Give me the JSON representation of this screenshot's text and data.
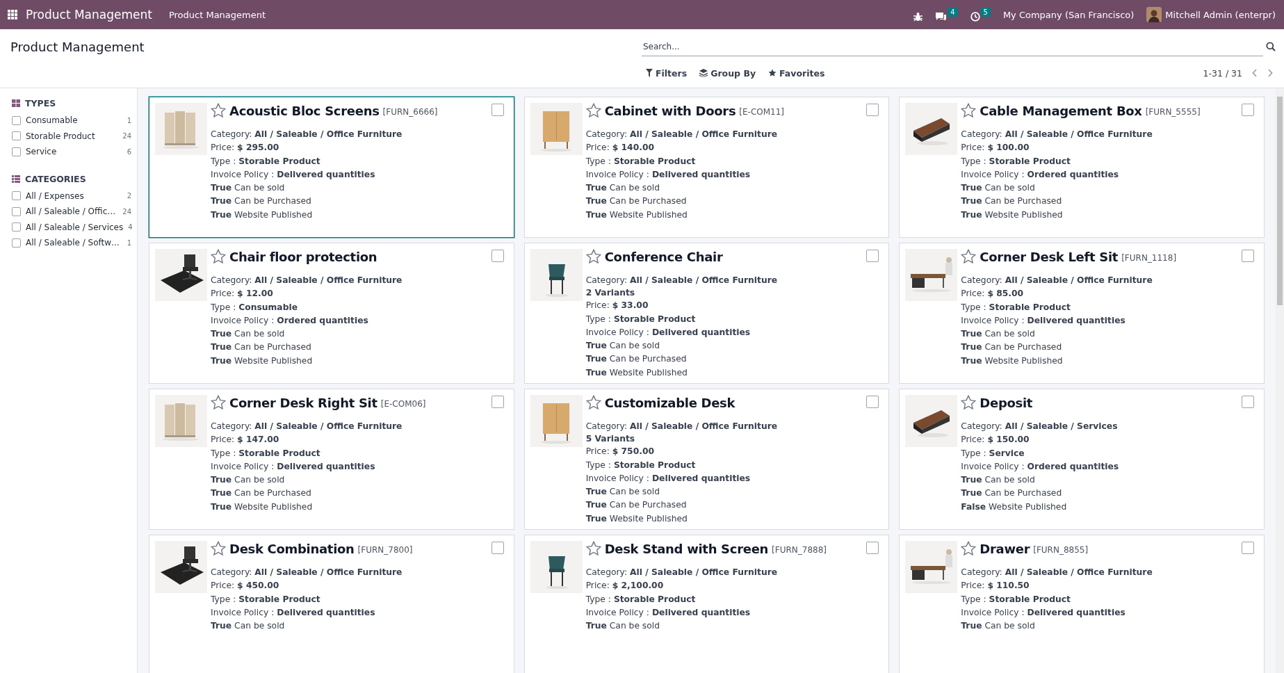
{
  "navbar": {
    "app_title": "Product Management",
    "menu": [
      {
        "label": "Product Management"
      }
    ],
    "messages_badge": "4",
    "activities_badge": "5",
    "company": "My Company (San Francisco)",
    "user": "Mitchell Admin (enterpr)"
  },
  "control_panel": {
    "title": "Product Management",
    "search": {
      "placeholder": "Search..."
    },
    "filters": "Filters",
    "group_by": "Group By",
    "favorites": "Favorites",
    "pager": "1-31 / 31"
  },
  "search_panel": {
    "sections": [
      {
        "kind": "types",
        "title": "TYPES",
        "items": [
          {
            "label": "Consumable",
            "count": "1",
            "checked": false
          },
          {
            "label": "Storable Product",
            "count": "24",
            "checked": false
          },
          {
            "label": "Service",
            "count": "6",
            "checked": false
          }
        ]
      },
      {
        "kind": "categories",
        "title": "CATEGORIES",
        "items": [
          {
            "label": "All / Expenses",
            "count": "2",
            "checked": false
          },
          {
            "label": "All / Saleable / Offic…",
            "count": "24",
            "checked": false
          },
          {
            "label": "All / Saleable / Services",
            "count": "4",
            "checked": false
          },
          {
            "label": "All / Saleable / Softw…",
            "count": "1",
            "checked": false
          }
        ]
      }
    ]
  },
  "cards": [
    {
      "name": "Acoustic Bloc Screens",
      "ref": "[FURN_6666]",
      "favorite": false,
      "checked": false,
      "focused": true,
      "details": [
        {
          "kind": "text",
          "text": "Category: **All / Saleable / Office Furniture**"
        },
        {
          "kind": "text",
          "text": "Price: **$ 295.00**"
        },
        {
          "kind": "text",
          "text": "Type : **Storable Product**"
        },
        {
          "kind": "text",
          "text": "Invoice Policy : **Delivered quantities**"
        },
        {
          "kind": "text",
          "text": "**True** Can be sold"
        },
        {
          "kind": "text",
          "text": "**True** Can be Purchased"
        },
        {
          "kind": "text",
          "text": "**True** Website Published"
        }
      ]
    },
    {
      "name": "Cabinet with Doors",
      "ref": "[E-COM11]",
      "favorite": false,
      "checked": false,
      "focused": false,
      "details": [
        {
          "kind": "text",
          "text": "Category: **All / Saleable / Office Furniture**"
        },
        {
          "kind": "text",
          "text": "Price: **$ 140.00**"
        },
        {
          "kind": "text",
          "text": "Type : **Storable Product**"
        },
        {
          "kind": "text",
          "text": "Invoice Policy : **Delivered quantities**"
        },
        {
          "kind": "text",
          "text": "**True** Can be sold"
        },
        {
          "kind": "text",
          "text": "**True** Can be Purchased"
        },
        {
          "kind": "text",
          "text": "**True** Website Published"
        }
      ]
    },
    {
      "name": "Cable Management Box",
      "ref": "[FURN_5555]",
      "favorite": false,
      "checked": false,
      "focused": false,
      "details": [
        {
          "kind": "text",
          "text": "Category: **All / Saleable / Office Furniture**"
        },
        {
          "kind": "text",
          "text": "Price: **$ 100.00**"
        },
        {
          "kind": "text",
          "text": "Type : **Storable Product**"
        },
        {
          "kind": "text",
          "text": "Invoice Policy : **Ordered quantities**"
        },
        {
          "kind": "text",
          "text": "**True** Can be sold"
        },
        {
          "kind": "text",
          "text": "**True** Can be Purchased"
        },
        {
          "kind": "text",
          "text": "**True** Website Published"
        }
      ]
    },
    {
      "name": "Chair floor protection",
      "favorite": false,
      "checked": false,
      "focused": false,
      "details": [
        {
          "kind": "text",
          "text": "Category: **All / Saleable / Office Furniture**"
        },
        {
          "kind": "text",
          "text": "Price: **$ 12.00**"
        },
        {
          "kind": "text",
          "text": "Type : **Consumable**"
        },
        {
          "kind": "text",
          "text": "Invoice Policy : **Ordered quantities**"
        },
        {
          "kind": "text",
          "text": "**True** Can be sold"
        },
        {
          "kind": "text",
          "text": "**True** Can be Purchased"
        },
        {
          "kind": "text",
          "text": "**True** Website Published"
        }
      ]
    },
    {
      "name": "Conference Chair",
      "favorite": false,
      "checked": false,
      "focused": false,
      "details": [
        {
          "kind": "text",
          "text": "Category: **All / Saleable / Office Furniture**"
        },
        {
          "kind": "variants",
          "text": "2 Variants"
        },
        {
          "kind": "text",
          "text": "Price: **$ 33.00**"
        },
        {
          "kind": "text",
          "text": "Type : **Storable Product**"
        },
        {
          "kind": "text",
          "text": "Invoice Policy : **Delivered quantities**"
        },
        {
          "kind": "text",
          "text": "**True** Can be sold"
        },
        {
          "kind": "text",
          "text": "**True** Can be Purchased"
        },
        {
          "kind": "text",
          "text": "**True** Website Published"
        }
      ]
    },
    {
      "name": "Corner Desk Left Sit",
      "ref": "[FURN_1118]",
      "favorite": false,
      "checked": false,
      "focused": false,
      "details": [
        {
          "kind": "text",
          "text": "Category: **All / Saleable / Office Furniture**"
        },
        {
          "kind": "text",
          "text": "Price: **$ 85.00**"
        },
        {
          "kind": "text",
          "text": "Type : **Storable Product**"
        },
        {
          "kind": "text",
          "text": "Invoice Policy : **Delivered quantities**"
        },
        {
          "kind": "text",
          "text": "**True** Can be sold"
        },
        {
          "kind": "text",
          "text": "**True** Can be Purchased"
        },
        {
          "kind": "text",
          "text": "**True** Website Published"
        }
      ]
    },
    {
      "name": "Corner Desk Right Sit",
      "ref": "[E-COM06]",
      "favorite": false,
      "checked": false,
      "focused": false,
      "details": [
        {
          "kind": "text",
          "text": "Category: **All / Saleable / Office Furniture**"
        },
        {
          "kind": "text",
          "text": "Price: **$ 147.00**"
        },
        {
          "kind": "text",
          "text": "Type : **Storable Product**"
        },
        {
          "kind": "text",
          "text": "Invoice Policy : **Delivered quantities**"
        },
        {
          "kind": "text",
          "text": "**True** Can be sold"
        },
        {
          "kind": "text",
          "text": "**True** Can be Purchased"
        },
        {
          "kind": "text",
          "text": "**True** Website Published"
        }
      ]
    },
    {
      "name": "Customizable Desk",
      "favorite": false,
      "checked": false,
      "focused": false,
      "details": [
        {
          "kind": "text",
          "text": "Category: **All / Saleable / Office Furniture**"
        },
        {
          "kind": "variants",
          "text": "5 Variants"
        },
        {
          "kind": "text",
          "text": "Price: **$ 750.00**"
        },
        {
          "kind": "text",
          "text": "Type : **Storable Product**"
        },
        {
          "kind": "text",
          "text": "Invoice Policy : **Delivered quantities**"
        },
        {
          "kind": "text",
          "text": "**True** Can be sold"
        },
        {
          "kind": "text",
          "text": "**True** Can be Purchased"
        },
        {
          "kind": "text",
          "text": "**True** Website Published"
        }
      ]
    },
    {
      "name": "Deposit",
      "favorite": false,
      "checked": false,
      "focused": false,
      "details": [
        {
          "kind": "text",
          "text": "Category: **All / Saleable / Services**"
        },
        {
          "kind": "text",
          "text": "Price: **$ 150.00**"
        },
        {
          "kind": "text",
          "text": "Type : **Service**"
        },
        {
          "kind": "text",
          "text": "Invoice Policy : **Ordered quantities**"
        },
        {
          "kind": "text",
          "text": "**True** Can be sold"
        },
        {
          "kind": "text",
          "text": "**True** Can be Purchased"
        },
        {
          "kind": "text",
          "text": "**False** Website Published"
        }
      ]
    },
    {
      "name": "Desk Combination",
      "ref": "[FURN_7800]",
      "favorite": false,
      "checked": false,
      "focused": false,
      "details": [
        {
          "kind": "text",
          "text": "Category: **All / Saleable / Office Furniture**"
        },
        {
          "kind": "text",
          "text": "Price: **$ 450.00**"
        },
        {
          "kind": "text",
          "text": "Type : **Storable Product**"
        },
        {
          "kind": "text",
          "text": "Invoice Policy : **Delivered quantities**"
        },
        {
          "kind": "text",
          "text": "**True** Can be sold"
        }
      ]
    },
    {
      "name": "Desk Stand with Screen",
      "ref": "[FURN_7888]",
      "favorite": false,
      "checked": false,
      "focused": false,
      "details": [
        {
          "kind": "text",
          "text": "Category: **All / Saleable / Office Furniture**"
        },
        {
          "kind": "text",
          "text": "Price: **$ 2,100.00**"
        },
        {
          "kind": "text",
          "text": "Type : **Storable Product**"
        },
        {
          "kind": "text",
          "text": "Invoice Policy : **Delivered quantities**"
        },
        {
          "kind": "text",
          "text": "**True** Can be sold"
        }
      ]
    },
    {
      "name": "Drawer",
      "ref": "[FURN_8855]",
      "favorite": false,
      "checked": false,
      "focused": false,
      "details": [
        {
          "kind": "text",
          "text": "Category: **All / Saleable / Office Furniture**"
        },
        {
          "kind": "text",
          "text": "Price: **$ 110.50**"
        },
        {
          "kind": "text",
          "text": "Type : **Storable Product**"
        },
        {
          "kind": "text",
          "text": "Invoice Policy : **Delivered quantities**"
        },
        {
          "kind": "text",
          "text": "**True** Can be sold"
        }
      ]
    }
  ]
}
